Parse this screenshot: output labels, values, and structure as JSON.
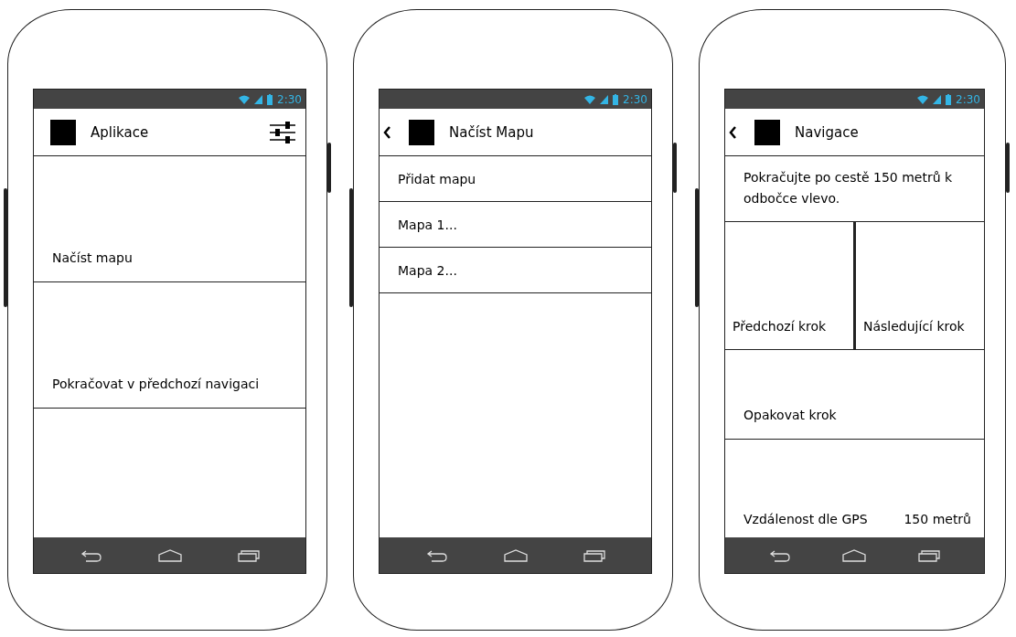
{
  "phones": [
    {
      "status_bar": {
        "time": "2:30"
      },
      "app_bar": {
        "title": "Aplikace",
        "back": false,
        "settings": true
      },
      "content": [
        {
          "kind": "tile",
          "text": "Načíst mapu"
        },
        {
          "kind": "tile",
          "text": "Pokračovat v předchozí navigaci"
        }
      ]
    },
    {
      "status_bar": {
        "time": "2:30"
      },
      "app_bar": {
        "title": "Načíst Mapu",
        "back": true,
        "settings": false
      },
      "content": [
        {
          "kind": "list_item",
          "text": "Přidat mapu"
        },
        {
          "kind": "list_item",
          "text": "Mapa 1..."
        },
        {
          "kind": "list_item",
          "text": "Mapa 2..."
        }
      ]
    },
    {
      "status_bar": {
        "time": "2:30"
      },
      "app_bar": {
        "title": "Navigace",
        "back": true,
        "settings": false
      },
      "content": [
        {
          "kind": "message",
          "text": "Pokračujte po cestě 150 metrů k odbočce vlevo."
        },
        {
          "kind": "tile_pair",
          "tiles": [
            "Předchozí krok",
            "Následující krok"
          ]
        },
        {
          "kind": "tile",
          "text": "Opakovat krok"
        },
        {
          "kind": "info_row",
          "label": "Vzdálenost dle GPS",
          "value": "150 metrů"
        }
      ]
    }
  ]
}
